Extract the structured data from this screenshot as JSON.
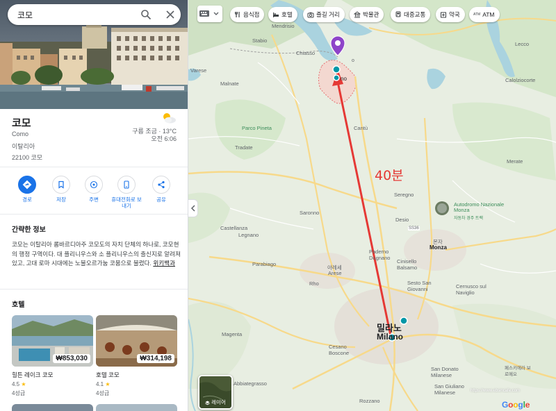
{
  "search": {
    "query": "코모"
  },
  "place": {
    "title": "코모",
    "subtitle": "Como",
    "country": "이탈리아",
    "postal": "22100 코모",
    "weather_desc": "구름 조금 · 13°C",
    "weather_time": "오전 6:06"
  },
  "actions": [
    {
      "label": "경로",
      "icon": "directions-icon"
    },
    {
      "label": "저장",
      "icon": "bookmark-icon"
    },
    {
      "label": "주변",
      "icon": "nearby-icon"
    },
    {
      "label": "휴대전화로 보내기",
      "icon": "phone-icon"
    },
    {
      "label": "공유",
      "icon": "share-icon"
    }
  ],
  "overview": {
    "heading": "간략한 정보",
    "text": "코모는 이탈리아 롬바르디아주 코모도의 자치 단체의 하나로, 코모현의 행정 구역이다. 대 플리니우스와 소 플리니우스의 출신지로 알려져 있고, 고대 로마 시대에는 노불오르가눔 코뭄으로 불렸다. ",
    "link": "위키백과"
  },
  "hotels": {
    "heading": "호텔",
    "items": [
      {
        "name": "힐튼 레이크 코모",
        "price": "₩853,030",
        "rating": "4.5",
        "class": "4성급"
      },
      {
        "name": "호텔 코모",
        "price": "₩314,198",
        "rating": "4.1",
        "class": "4성급"
      }
    ]
  },
  "chips": [
    {
      "label": "음식점",
      "icon": "restaurant-icon"
    },
    {
      "label": "호텔",
      "icon": "hotel-icon"
    },
    {
      "label": "즐길 거리",
      "icon": "camera-icon"
    },
    {
      "label": "박물관",
      "icon": "museum-icon"
    },
    {
      "label": "대중교통",
      "icon": "transit-icon"
    },
    {
      "label": "약국",
      "icon": "pharmacy-icon"
    },
    {
      "label": "ATM",
      "icon": "atm-icon",
      "prefix": "ATM"
    }
  ],
  "map": {
    "annotation": "40분",
    "layers_label": "레이어",
    "google": "Google",
    "watermark": "https://www.ebsincafe.com",
    "labels": {
      "mendrisio": "Mendrisio",
      "stabio": "Stabio",
      "varese": "Varese",
      "chiasso": "Chiasso",
      "malnate": "Malnate",
      "parco_pineta": "Parco Pineta",
      "cantu": "Cantù",
      "tradate": "Tradate",
      "seregno": "Seregno",
      "merate": "Merate",
      "lecco": "Lecco",
      "calolziocorte": "Calolziocorte",
      "saronno": "Saronno",
      "desio": "Desio",
      "autodromo": "Autodromo Nazionale Monza",
      "autodromo_ko": "자동차 경주 트랙",
      "castellanza": "Castellanza",
      "legnano": "Legnano",
      "monza": "Monza",
      "monza_ko": "몬자",
      "paderno": "Paderno Dugnano",
      "cinisello": "Cinisello Balsamo",
      "parabiago": "Parabiago",
      "arese": "Arese",
      "arese_ko": "아레세",
      "rho": "Rho",
      "sesto": "Sesto San Giovanni",
      "cernusco": "Cernusco sul Naviglio",
      "milano_ko": "밀라노",
      "milano": "Milano",
      "magenta": "Magenta",
      "cesano": "Cesano Boscone",
      "rozzano": "Rozzano",
      "sandonato": "San Donato Milanese",
      "sangiuliano": "San Giuliano Milanese",
      "peschiera": "페스키에라 보로메오",
      "abbiategrasso": "Abbiategrasso",
      "como": "no",
      "como_top": "o",
      "ssp": "SS36"
    }
  }
}
